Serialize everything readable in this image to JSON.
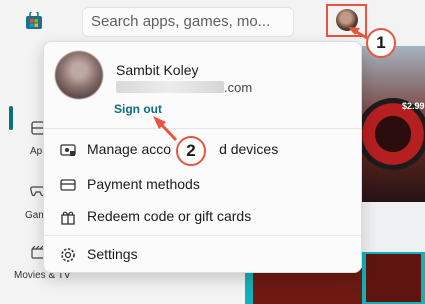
{
  "search": {
    "placeholder": "Search apps, games, mo..."
  },
  "account": {
    "name": "Sambit Koley",
    "email_suffix": ".com",
    "sign_out_label": "Sign out"
  },
  "menu": [
    {
      "label": "Manage account and devices",
      "icon": "manage-account-icon"
    },
    {
      "label": "Payment methods",
      "icon": "card-icon"
    },
    {
      "label": "Redeem code or gift cards",
      "icon": "gift-icon"
    },
    {
      "label": "Settings",
      "icon": "gear-icon"
    }
  ],
  "menu_label_fragments": {
    "manage_left": "Manage acco",
    "manage_right": "d devices"
  },
  "nav": {
    "apps_label": "Ap",
    "gaming_label": "Gam",
    "movies_label": "Movies & TV"
  },
  "background": {
    "badge": "$2.99"
  },
  "callouts": {
    "one": "1",
    "two": "2"
  },
  "colors": {
    "accent": "#0f6e7e",
    "callout": "#e8553f"
  }
}
